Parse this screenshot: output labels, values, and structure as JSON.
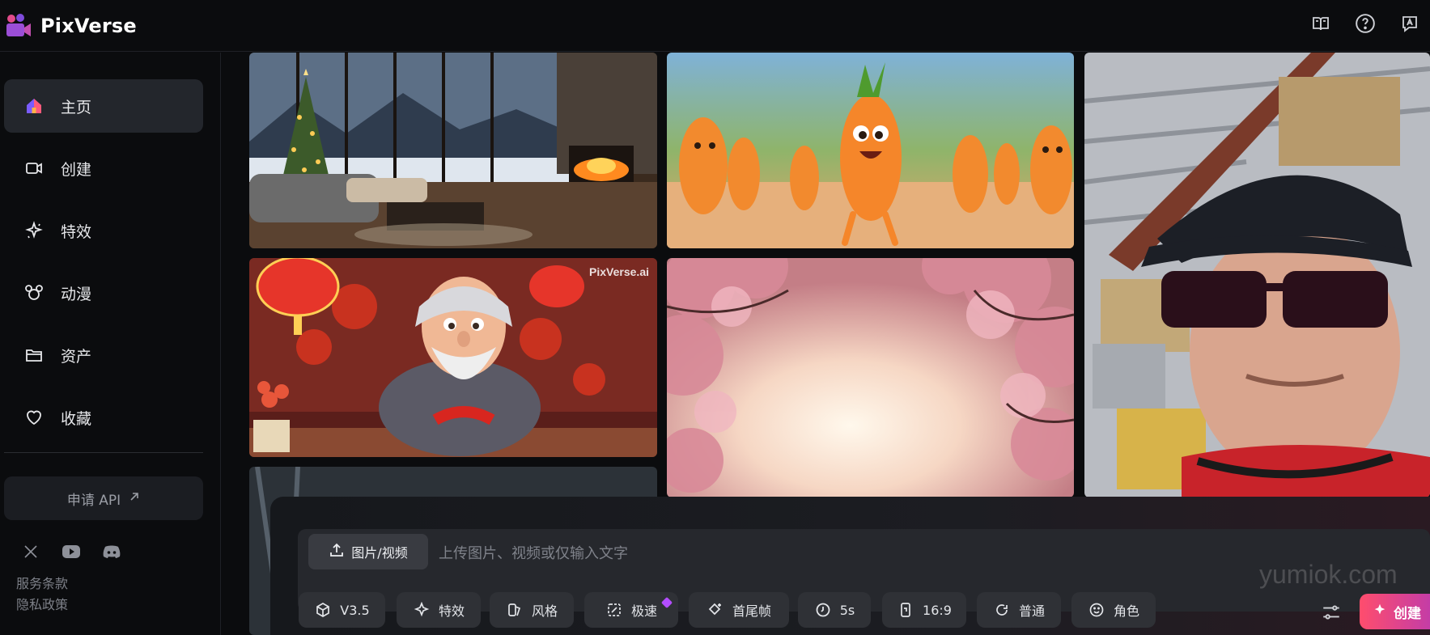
{
  "app": {
    "name": "PixVerse",
    "brand_color": "#b14fd1"
  },
  "header": {
    "icons": [
      "book-icon",
      "help-icon",
      "feedback-icon"
    ]
  },
  "sidebar": {
    "items": [
      {
        "label": "主页",
        "icon": "home-icon",
        "active": true
      },
      {
        "label": "创建",
        "icon": "video-camera-icon",
        "active": false
      },
      {
        "label": "特效",
        "icon": "sparkle-icon",
        "active": false
      },
      {
        "label": "动漫",
        "icon": "mouse-ears-icon",
        "active": false
      },
      {
        "label": "资产",
        "icon": "folder-icon",
        "active": false
      },
      {
        "label": "收藏",
        "icon": "heart-icon",
        "active": false
      }
    ],
    "api_button": "申请 API",
    "social": [
      "x-icon",
      "youtube-icon",
      "discord-icon"
    ],
    "footer_links": [
      "服务条款",
      "隐私政策"
    ]
  },
  "gallery": {
    "tiles": [
      {
        "name": "christmas-living-room",
        "watermark": ""
      },
      {
        "name": "dancing-carrots",
        "watermark": ""
      },
      {
        "name": "man-in-cap-sunglasses",
        "watermark": ""
      },
      {
        "name": "grandpa-paper-cutting",
        "watermark": "PixVerse.ai"
      },
      {
        "name": "cherry-blossoms",
        "watermark": ""
      },
      {
        "name": "forest-partial",
        "watermark": ""
      }
    ]
  },
  "composer": {
    "upload_label": "图片/视频",
    "placeholder": "上传图片、视频或仅输入文字",
    "tools": [
      {
        "label": "V3.5",
        "icon": "cube-icon"
      },
      {
        "label": "特效",
        "icon": "sparkle-icon"
      },
      {
        "label": "风格",
        "icon": "style-icon"
      },
      {
        "label": "极速",
        "icon": "speed-icon",
        "premium": true
      },
      {
        "label": "首尾帧",
        "icon": "keyframe-icon"
      },
      {
        "label": "5s",
        "icon": "clock-icon"
      },
      {
        "label": "16:9",
        "icon": "aspect-ratio-icon"
      },
      {
        "label": "普通",
        "icon": "motion-icon"
      },
      {
        "label": "角色",
        "icon": "smile-icon"
      }
    ],
    "create_label": "创建"
  },
  "overlay_watermark": "yumiok.com"
}
